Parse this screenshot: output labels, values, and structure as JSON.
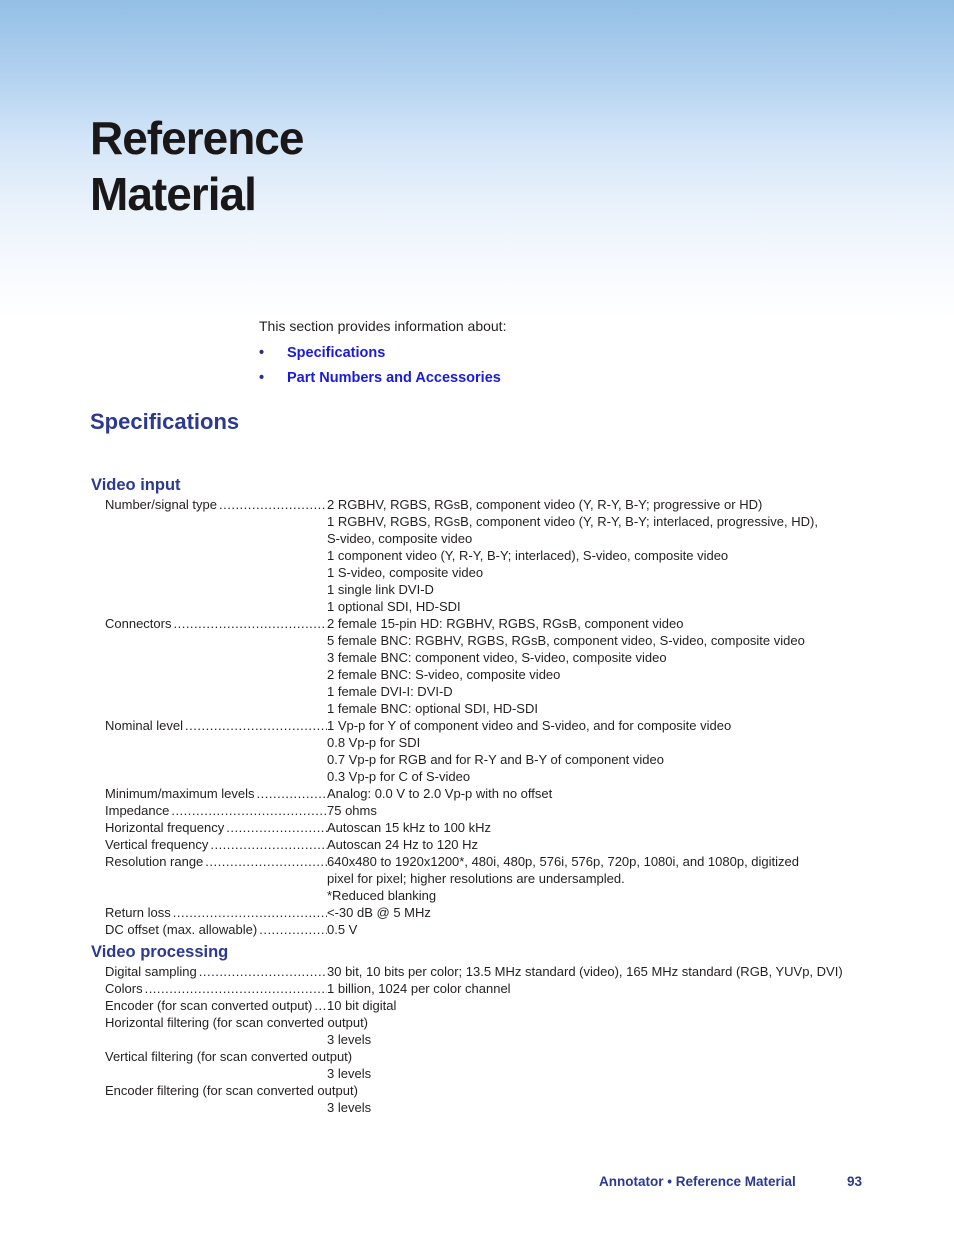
{
  "page": {
    "title_line1": "Reference",
    "title_line2": "Material",
    "intro": "This section provides information about:",
    "toc": [
      {
        "bullet": "•",
        "label": "Specifications"
      },
      {
        "bullet": "•",
        "label": "Part Numbers and Accessories"
      }
    ],
    "section_heading": "Specifications"
  },
  "video_input": {
    "heading": "Video input",
    "rows": [
      {
        "label": "Number/signal type",
        "values": [
          "2 RGBHV, RGBS, RGsB, component video (Y, R-Y, B-Y; progressive or HD)",
          "1 RGBHV, RGBS, RGsB, component video (Y, R-Y, B-Y; interlaced, progressive, HD),",
          "S-video, composite video",
          "1 component video (Y, R-Y, B-Y; interlaced), S-video, composite video",
          "1 S-video, composite video",
          "1 single link DVI-D",
          "1 optional SDI, HD-SDI"
        ]
      },
      {
        "label": "Connectors",
        "values": [
          "2 female 15-pin HD: RGBHV, RGBS, RGsB, component video",
          "5 female BNC: RGBHV, RGBS, RGsB, component video, S-video, composite video",
          "3 female BNC: component video, S-video, composite video",
          "2 female BNC: S-video, composite video",
          "1 female DVI-I: DVI-D",
          "1 female BNC: optional SDI, HD-SDI"
        ]
      },
      {
        "label": "Nominal level",
        "values": [
          "1 Vp-p for Y of component video and S-video, and for composite video",
          "0.8 Vp-p for SDI",
          "0.7 Vp-p for RGB and for R-Y and B-Y of component video",
          "0.3 Vp-p for C of S-video"
        ]
      },
      {
        "label": "Minimum/maximum levels",
        "values": [
          "Analog: 0.0 V to 2.0 Vp-p with no offset"
        ]
      },
      {
        "label": "Impedance",
        "values": [
          "75 ohms"
        ]
      },
      {
        "label": "Horizontal frequency",
        "values": [
          "Autoscan 15 kHz to 100 kHz"
        ]
      },
      {
        "label": "Vertical frequency",
        "values": [
          "Autoscan 24 Hz to 120 Hz"
        ]
      },
      {
        "label": "Resolution range",
        "values": [
          "640x480 to 1920x1200*, 480i, 480p, 576i, 576p, 720p, 1080i, and 1080p, digitized",
          "pixel for pixel; higher resolutions are undersampled.",
          "*Reduced blanking"
        ]
      },
      {
        "label": "Return loss",
        "values": [
          "<-30 dB @ 5 MHz"
        ]
      },
      {
        "label": "DC offset (max. allowable)",
        "values": [
          "0.5 V"
        ]
      }
    ]
  },
  "video_processing": {
    "heading": "Video processing",
    "rows": [
      {
        "label": "Digital sampling",
        "values": [
          "30 bit, 10 bits per color; 13.5 MHz standard (video), 165 MHz standard (RGB, YUVp, DVI)"
        ]
      },
      {
        "label": "Colors",
        "values": [
          "1 billion, 1024 per color channel"
        ]
      },
      {
        "label": "Encoder (for scan converted output)",
        "values": [
          "10 bit digital"
        ]
      }
    ],
    "wide_rows": [
      {
        "label": "Horizontal filtering (for scan converted output)",
        "value": "3 levels"
      },
      {
        "label": "Vertical filtering (for scan converted output)",
        "value": "3 levels"
      },
      {
        "label": "Encoder filtering (for scan converted output)",
        "value": "3 levels"
      }
    ]
  },
  "footer": {
    "text": "Annotator • Reference Material",
    "page_number": "93"
  }
}
